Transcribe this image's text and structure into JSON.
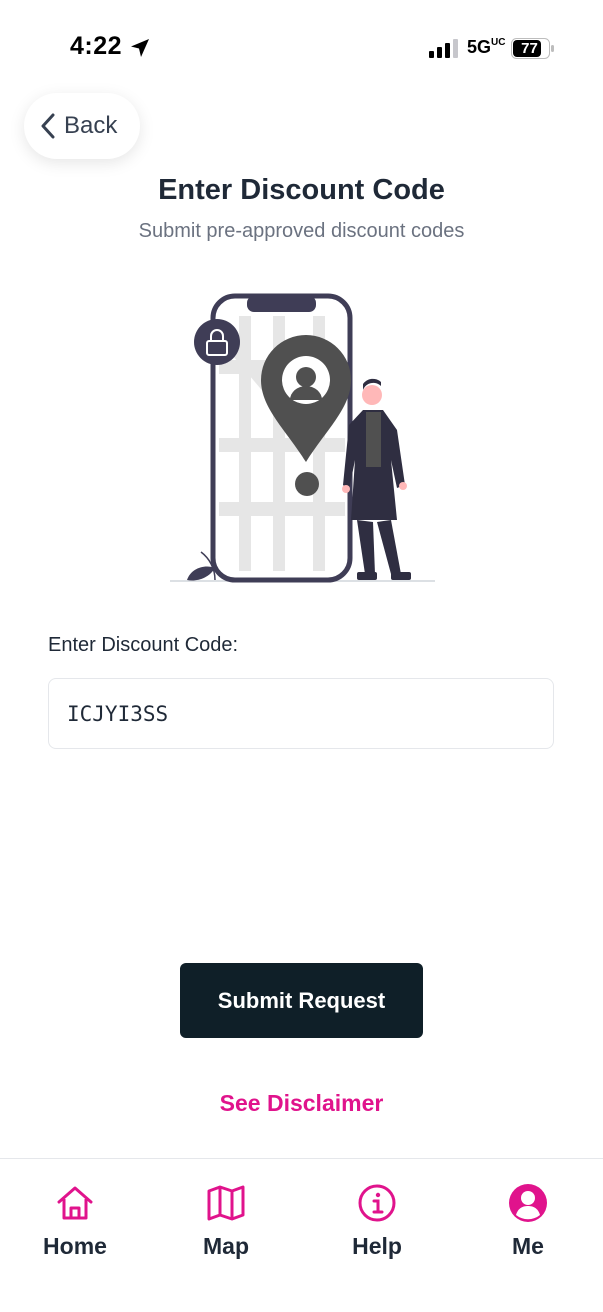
{
  "status_bar": {
    "time": "4:22",
    "network": "5G",
    "network_sup": "UC",
    "battery": "77"
  },
  "back": {
    "label": "Back"
  },
  "header": {
    "title": "Enter Discount Code",
    "subtitle": "Submit pre-approved discount codes"
  },
  "form": {
    "label": "Enter Discount Code:",
    "value": "ICJYI3SS"
  },
  "actions": {
    "submit_label": "Submit Request",
    "disclaimer_label": "See Disclaimer"
  },
  "colors": {
    "accent": "#e0138c",
    "button_bg": "#0f1f28"
  },
  "nav": {
    "items": [
      {
        "label": "Home",
        "icon": "home-icon"
      },
      {
        "label": "Map",
        "icon": "map-icon"
      },
      {
        "label": "Help",
        "icon": "info-icon"
      },
      {
        "label": "Me",
        "icon": "user-icon"
      }
    ]
  }
}
